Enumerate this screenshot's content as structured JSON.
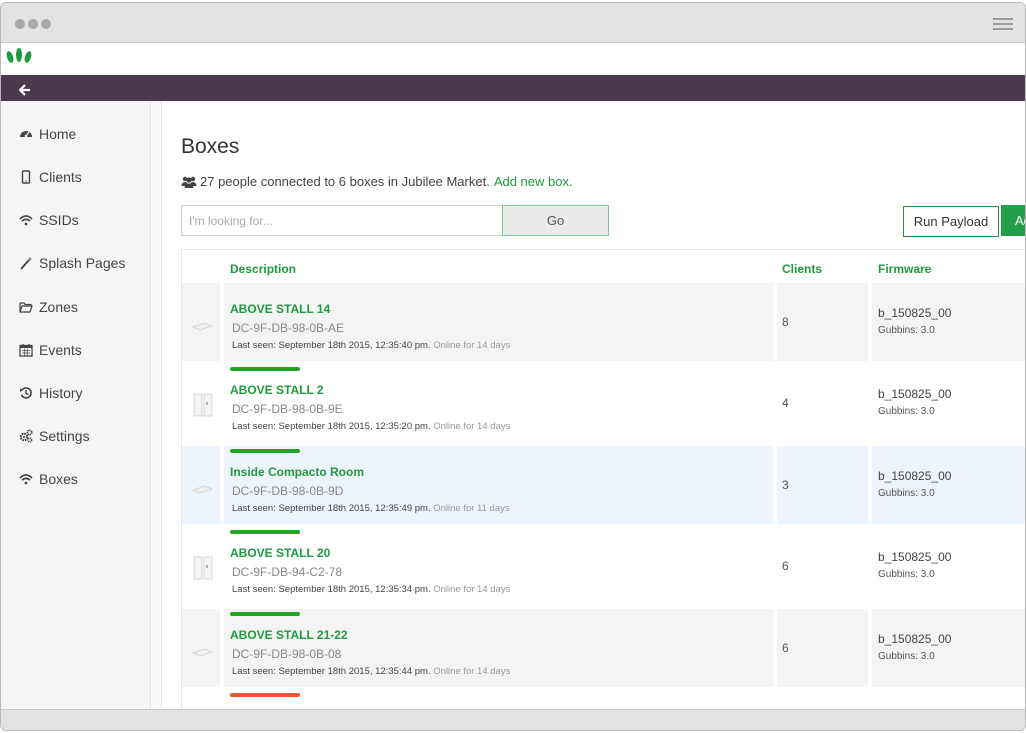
{
  "nav": {
    "items": [
      {
        "label": "Home",
        "icon": "dashboard-icon"
      },
      {
        "label": "Clients",
        "icon": "mobile-icon"
      },
      {
        "label": "SSIDs",
        "icon": "wifi-icon"
      },
      {
        "label": "Splash Pages",
        "icon": "magic-wand-icon"
      },
      {
        "label": "Zones",
        "icon": "folder-open-icon"
      },
      {
        "label": "Events",
        "icon": "calendar-icon"
      },
      {
        "label": "History",
        "icon": "history-icon"
      },
      {
        "label": "Settings",
        "icon": "cogs-icon"
      },
      {
        "label": "Boxes",
        "icon": "wifi-icon"
      }
    ]
  },
  "page": {
    "title": "Boxes",
    "summary_text": "27 people connected to 6 boxes in Jubilee Market.",
    "add_link": "Add new box."
  },
  "search": {
    "placeholder": "I'm looking for...",
    "go_label": "Go"
  },
  "actions": {
    "run_payload": "Run Payload",
    "add_label": "Ad"
  },
  "table": {
    "headers": {
      "description": "Description",
      "clients": "Clients",
      "firmware": "Firmware"
    },
    "rows": [
      {
        "name": "ABOVE STALL 14",
        "mac": "DC-9F-DB-98-0B-AE",
        "last_seen": "Last seen: September 18th 2015, 12:35:40 pm.",
        "online": "Online for 14 days",
        "clients": "8",
        "firmware": "b_150825_00",
        "gubbins": "Gubbins: 3.0",
        "status": "online",
        "device": "flat"
      },
      {
        "name": "ABOVE STALL 2",
        "mac": "DC-9F-DB-98-0B-9E",
        "last_seen": "Last seen: September 18th 2015, 12:35:20 pm.",
        "online": "Online for 14 days",
        "clients": "4",
        "firmware": "b_150825_00",
        "gubbins": "Gubbins: 3.0",
        "status": "online",
        "device": "upright"
      },
      {
        "name": "Inside Compacto Room",
        "mac": "DC-9F-DB-98-0B-9D",
        "last_seen": "Last seen: September 18th 2015, 12:35:49 pm.",
        "online": "Online for 11 days",
        "clients": "3",
        "firmware": "b_150825_00",
        "gubbins": "Gubbins: 3.0",
        "status": "online",
        "device": "flat"
      },
      {
        "name": "ABOVE STALL 20",
        "mac": "DC-9F-DB-94-C2-78",
        "last_seen": "Last seen: September 18th 2015, 12:35:34 pm.",
        "online": "Online for 14 days",
        "clients": "6",
        "firmware": "b_150825_00",
        "gubbins": "Gubbins: 3.0",
        "status": "online",
        "device": "upright"
      },
      {
        "name": "ABOVE STALL 21-22",
        "mac": "DC-9F-DB-98-0B-08",
        "last_seen": "Last seen: September 18th 2015, 12:35:44 pm.",
        "online": "Online for 14 days",
        "clients": "6",
        "firmware": "b_150825_00",
        "gubbins": "Gubbins: 3.0",
        "status": "online",
        "device": "flat"
      }
    ],
    "partial_row_status": "offline"
  },
  "colors": {
    "brand_green": "#1f9a3f",
    "header_purple": "#4b3a4b",
    "status_online": "#22a524",
    "status_offline": "#f0562c"
  }
}
